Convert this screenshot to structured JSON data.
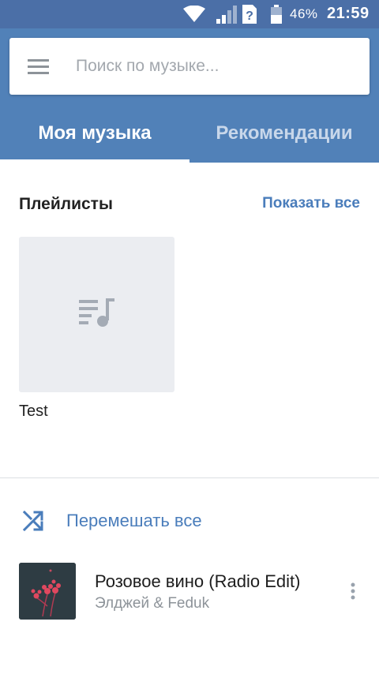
{
  "status_bar": {
    "battery_percent": "46%",
    "time": "21:59",
    "icons": [
      "wifi-icon",
      "signal-icon",
      "sim-unknown-icon",
      "battery-icon"
    ]
  },
  "search": {
    "placeholder": "Поиск по музыке..."
  },
  "tabs": [
    {
      "label": "Моя музыка",
      "active": true
    },
    {
      "label": "Рекомендации",
      "active": false
    }
  ],
  "playlists": {
    "title": "Плейлисты",
    "show_all": "Показать все",
    "items": [
      {
        "name": "Test",
        "icon": "playlist-icon"
      }
    ]
  },
  "shuffle": {
    "label": "Перемешать все",
    "icon": "shuffle-icon"
  },
  "tracks": [
    {
      "title": "Розовое вино (Radio Edit)",
      "artist": "Элджей & Feduk"
    }
  ],
  "colors": {
    "status_bar": "#4b6fa7",
    "app_bar": "#5181b8",
    "accent": "#4a7dbb"
  }
}
